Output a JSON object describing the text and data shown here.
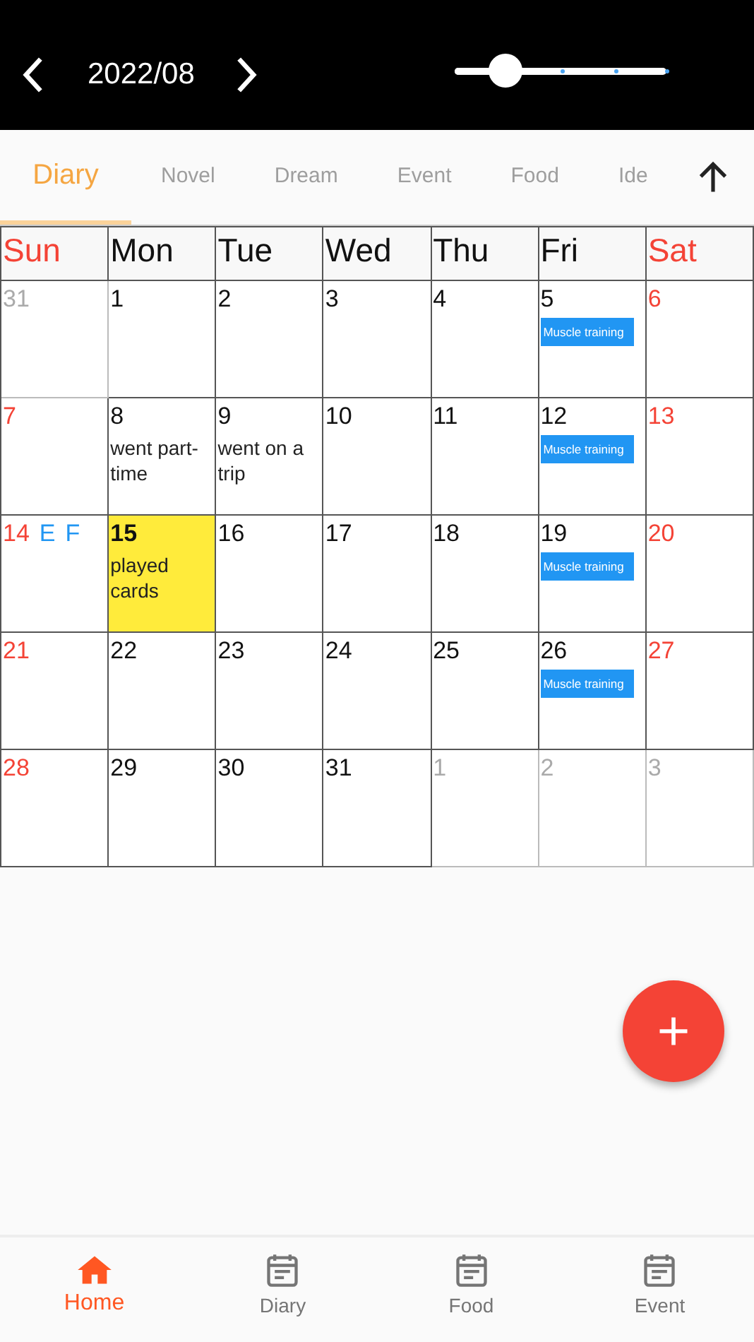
{
  "header": {
    "month": "2022/08",
    "slider": {
      "level": 0.24
    }
  },
  "tabs": [
    {
      "label": "Diary",
      "selected": true
    },
    {
      "label": "Novel",
      "selected": false
    },
    {
      "label": "Dream",
      "selected": false
    },
    {
      "label": "Event",
      "selected": false
    },
    {
      "label": "Food",
      "selected": false
    },
    {
      "label": "Ide",
      "selected": false
    }
  ],
  "weekdays": [
    "Sun",
    "Mon",
    "Tue",
    "Wed",
    "Thu",
    "Fri",
    "Sat"
  ],
  "weeks": [
    [
      {
        "day": "31",
        "muted": true,
        "today": false
      },
      {
        "day": "1",
        "muted": false,
        "today": false
      },
      {
        "day": "2",
        "muted": false,
        "today": false
      },
      {
        "day": "3",
        "muted": false,
        "today": false
      },
      {
        "day": "4",
        "muted": false,
        "today": false
      },
      {
        "day": "5",
        "muted": false,
        "today": false,
        "events": [
          "Muscle training"
        ]
      },
      {
        "day": "6",
        "muted": false,
        "today": false
      }
    ],
    [
      {
        "day": "7",
        "muted": false,
        "today": false
      },
      {
        "day": "8",
        "muted": false,
        "today": false,
        "note": "went part-time"
      },
      {
        "day": "9",
        "muted": false,
        "today": false,
        "note": "went on a trip"
      },
      {
        "day": "10",
        "muted": false,
        "today": false
      },
      {
        "day": "11",
        "muted": false,
        "today": false
      },
      {
        "day": "12",
        "muted": false,
        "today": false,
        "events": [
          "Muscle training"
        ]
      },
      {
        "day": "13",
        "muted": false,
        "today": false
      }
    ],
    [
      {
        "day": "14",
        "muted": false,
        "today": false,
        "tags": [
          "E",
          "F"
        ]
      },
      {
        "day": "15",
        "muted": false,
        "today": true,
        "note": "played cards"
      },
      {
        "day": "16",
        "muted": false,
        "today": false
      },
      {
        "day": "17",
        "muted": false,
        "today": false
      },
      {
        "day": "18",
        "muted": false,
        "today": false
      },
      {
        "day": "19",
        "muted": false,
        "today": false,
        "events": [
          "Muscle training"
        ]
      },
      {
        "day": "20",
        "muted": false,
        "today": false
      }
    ],
    [
      {
        "day": "21",
        "muted": false,
        "today": false
      },
      {
        "day": "22",
        "muted": false,
        "today": false
      },
      {
        "day": "23",
        "muted": false,
        "today": false
      },
      {
        "day": "24",
        "muted": false,
        "today": false
      },
      {
        "day": "25",
        "muted": false,
        "today": false
      },
      {
        "day": "26",
        "muted": false,
        "today": false,
        "events": [
          "Muscle training"
        ]
      },
      {
        "day": "27",
        "muted": false,
        "today": false
      }
    ],
    [
      {
        "day": "28",
        "muted": false,
        "today": false
      },
      {
        "day": "29",
        "muted": false,
        "today": false
      },
      {
        "day": "30",
        "muted": false,
        "today": false
      },
      {
        "day": "31",
        "muted": false,
        "today": false
      },
      {
        "day": "1",
        "muted": true,
        "today": false
      },
      {
        "day": "2",
        "muted": true,
        "today": false
      },
      {
        "day": "3",
        "muted": true,
        "today": false
      }
    ]
  ],
  "bottom_nav": [
    {
      "label": "Home",
      "kind": "home",
      "selected": true
    },
    {
      "label": "Diary",
      "kind": "calendar",
      "selected": false
    },
    {
      "label": "Food",
      "kind": "calendar",
      "selected": false
    },
    {
      "label": "Event",
      "kind": "calendar",
      "selected": false
    }
  ]
}
